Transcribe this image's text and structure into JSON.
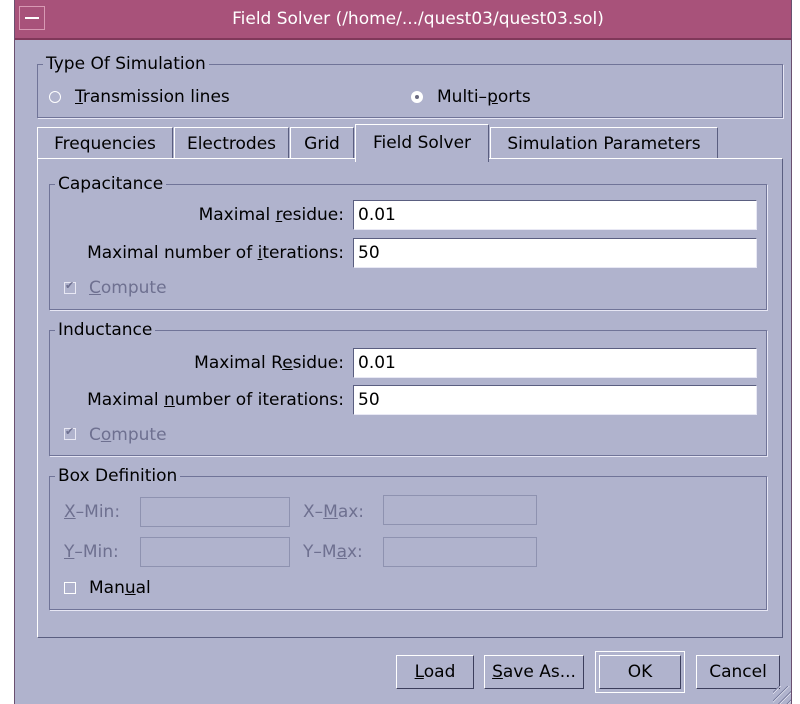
{
  "window": {
    "title": "Field Solver (/home/.../quest03/quest03.sol)"
  },
  "simulation_type": {
    "legend": "Type Of Simulation",
    "options": [
      {
        "mnemonic": "T",
        "rest": "ransmission lines",
        "selected": false
      },
      {
        "prefix": "Multi–",
        "mnemonic": "p",
        "rest": "orts",
        "selected": true
      }
    ]
  },
  "tabs": [
    {
      "label": "Frequencies",
      "active": false
    },
    {
      "label": "Electrodes",
      "active": false
    },
    {
      "label": "Grid",
      "active": false
    },
    {
      "label": "Field Solver",
      "active": true
    },
    {
      "label": "Simulation Parameters",
      "active": false
    }
  ],
  "capacitance": {
    "legend": "Capacitance",
    "residue_label": {
      "pre": "Maximal ",
      "mn": "r",
      "post": "esidue:"
    },
    "residue_value": "0.01",
    "iter_label": {
      "pre": "Maximal number of ",
      "mn": "i",
      "post": "terations:"
    },
    "iter_value": "50",
    "compute": {
      "pre": "",
      "mn": "C",
      "post": "ompute",
      "checked": true
    }
  },
  "inductance": {
    "legend": "Inductance",
    "residue_label": {
      "pre": "Maximal R",
      "mn": "e",
      "post": "sidue:"
    },
    "residue_value": "0.01",
    "iter_label": {
      "pre": "Maximal ",
      "mn": "n",
      "post": "umber of iterations:"
    },
    "iter_value": "50",
    "compute": {
      "pre": "C",
      "mn": "o",
      "post": "mpute",
      "checked": true
    }
  },
  "box": {
    "legend": "Box Definition",
    "xmin": {
      "pre": "",
      "mn": "X",
      "post": "–Min:",
      "value": ""
    },
    "xmax": {
      "pre": "X–",
      "mn": "M",
      "post": "ax:",
      "value": ""
    },
    "ymin": {
      "pre": "",
      "mn": "Y",
      "post": "–Min:",
      "value": ""
    },
    "ymax": {
      "pre": "Y–M",
      "mn": "a",
      "post": "x:",
      "value": ""
    },
    "manual": {
      "pre": "Man",
      "mn": "u",
      "post": "al",
      "checked": false
    }
  },
  "buttons": {
    "load": {
      "pre": "",
      "mn": "L",
      "post": "oad"
    },
    "save_as": {
      "pre": "",
      "mn": "S",
      "post": "ave As..."
    },
    "ok": "OK",
    "cancel": "Cancel"
  },
  "colors": {
    "titlebar": "#a8527a",
    "window_bg": "#b0b3cd",
    "field_bg": "#ffffff"
  }
}
